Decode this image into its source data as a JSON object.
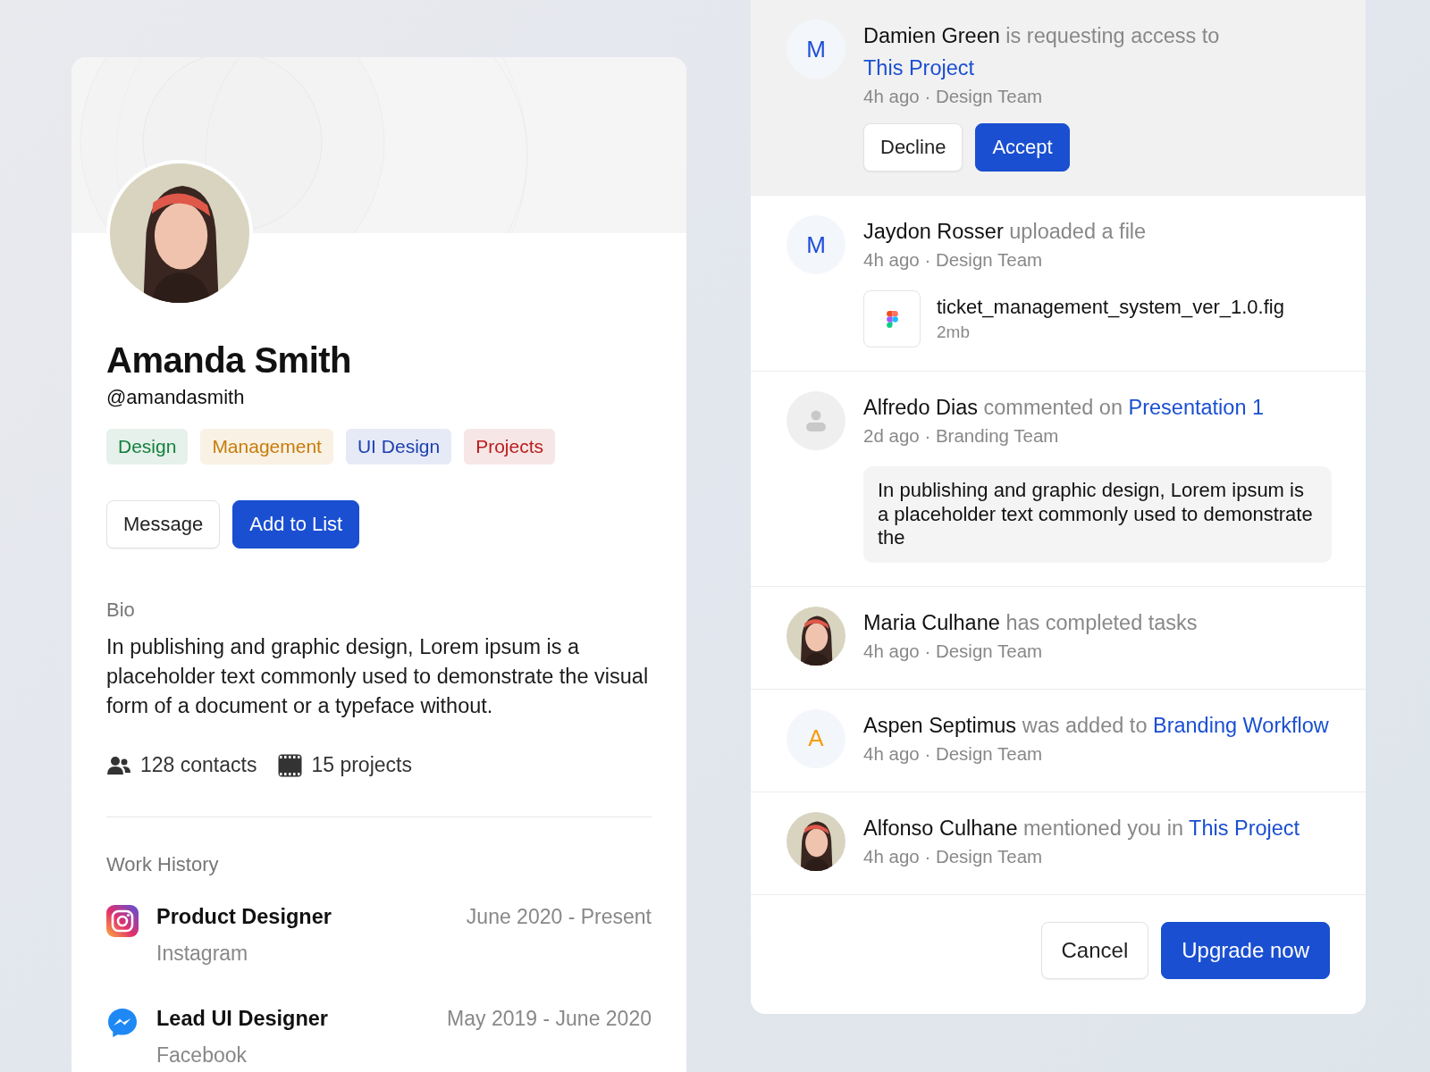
{
  "profile": {
    "name": "Amanda Smith",
    "handle": "@amandasmith",
    "tags": [
      {
        "label": "Design",
        "color": "#15803d"
      },
      {
        "label": "Management",
        "color": "#c77c0a"
      },
      {
        "label": "UI Design",
        "color": "#1e40af"
      },
      {
        "label": "Projects",
        "color": "#b91c1c"
      }
    ],
    "buttons": [
      {
        "label": "Message",
        "kind": "secondary"
      },
      {
        "label": "Add to List",
        "kind": "primary"
      }
    ],
    "bio_label": "Bio",
    "bio": "In publishing and graphic design, Lorem ipsum is a placeholder text commonly used to demonstrate the visual form of a document or a typeface without.",
    "stats": [
      {
        "kind": "contacts",
        "text": "128 contacts"
      },
      {
        "kind": "projects",
        "text": "15 projects"
      }
    ],
    "work_history_label": "Work History",
    "work_history": [
      {
        "kind": "instagram",
        "title": "Product Designer",
        "company": "Instagram",
        "period": "June 2020 - Present"
      },
      {
        "kind": "messenger",
        "title": "Lead UI Designer",
        "company": "Facebook",
        "period": "May 2019 - June 2020"
      }
    ]
  },
  "notifications": [
    {
      "avatar": {
        "kind": "letter",
        "letter": "M",
        "color": "#1d4ed8"
      },
      "actor": "Damien Green",
      "action": "is requesting access to",
      "link": "This Project",
      "link_break": true,
      "meta": "4h ago · Design Team",
      "highlighted": true,
      "attachment": {
        "kind": "actions",
        "buttons": [
          {
            "label": "Decline",
            "kind": "secondary"
          },
          {
            "label": "Accept",
            "kind": "primary"
          }
        ]
      }
    },
    {
      "avatar": {
        "kind": "letter",
        "letter": "M",
        "color": "#1d4ed8"
      },
      "actor": "Jaydon Rosser",
      "action": "uploaded a file",
      "meta": "4h ago · Design Team",
      "highlighted": false,
      "attachment": {
        "kind": "file",
        "name": "ticket_management_system_ver_1.0.fig",
        "size": "2mb"
      }
    },
    {
      "avatar": {
        "kind": "placeholder"
      },
      "actor": "Alfredo Dias",
      "action": "commented on",
      "link": "Presentation 1",
      "meta": "2d ago · Branding Team",
      "highlighted": false,
      "attachment": {
        "kind": "comment",
        "text": "In publishing and graphic design, Lorem ipsum is a placeholder text commonly used to demonstrate the"
      }
    },
    {
      "actor": "Maria Culhane",
      "action": "has completed tasks",
      "meta": "4h ago · Design Team",
      "highlighted": false
    },
    {
      "avatar": {
        "kind": "letter",
        "letter": "A",
        "color": "#f59e0b"
      },
      "actor": "Aspen Septimus",
      "action": "was added to",
      "link": "Branding Workflow",
      "meta": "4h ago · Design Team",
      "highlighted": false
    },
    {
      "actor": "Alfonso Culhane",
      "action": "mentioned you in",
      "link": "This Project",
      "meta": "4h ago · Design Team",
      "highlighted": false
    }
  ],
  "footer_buttons": [
    {
      "label": "Cancel",
      "kind": "secondary"
    },
    {
      "label": "Upgrade now",
      "kind": "primary"
    }
  ]
}
